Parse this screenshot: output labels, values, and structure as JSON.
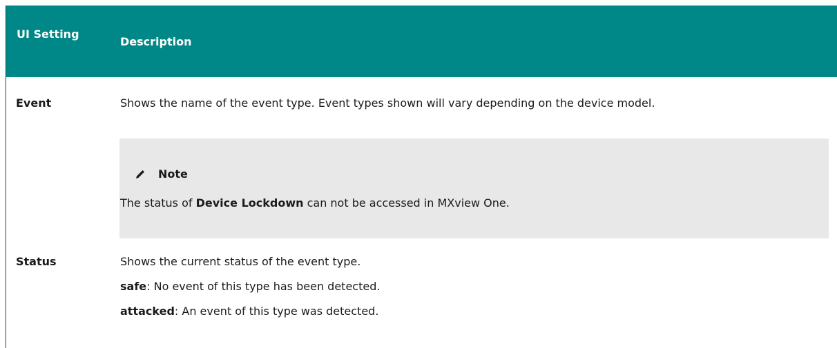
{
  "table": {
    "headers": {
      "setting": "UI Setting",
      "description": "Description"
    },
    "rows": [
      {
        "setting": "Event",
        "description": "Shows the name of the event type. Event types shown will vary depending on the device model.",
        "note": {
          "icon": "pencil-icon",
          "title": "Note",
          "text_before": "The status of ",
          "text_bold": "Device Lockdown",
          "text_after": " can not be accessed in MXview One."
        }
      },
      {
        "setting": "Status",
        "description": "Shows the current status of the event type.",
        "values": [
          {
            "term": "safe",
            "desc": ": No event of this type has been detected."
          },
          {
            "term": "attacked",
            "desc": ": An event of this type was detected."
          }
        ]
      }
    ]
  }
}
